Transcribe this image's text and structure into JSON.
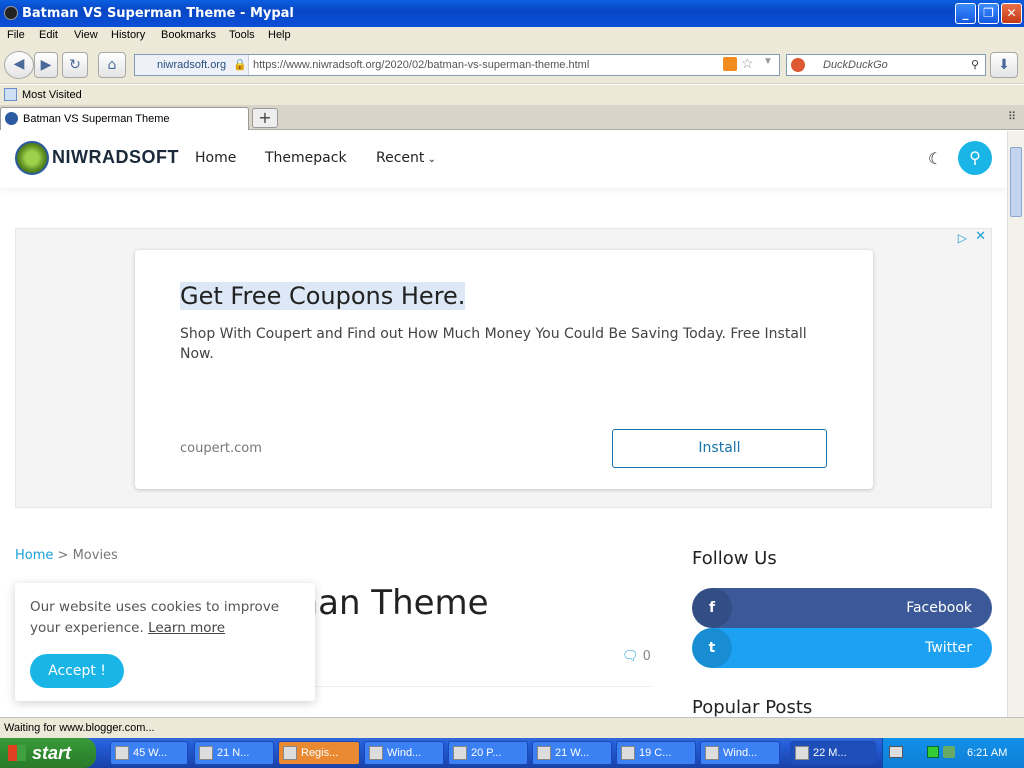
{
  "window": {
    "title": "Batman VS Superman Theme - Mypal"
  },
  "menu": [
    "File",
    "Edit",
    "View",
    "History",
    "Bookmarks",
    "Tools",
    "Help"
  ],
  "navbar": {
    "identity": "niwradsoft.org",
    "url": "https://www.niwradsoft.org/2020/02/batman-vs-superman-theme.html",
    "search_placeholder": "DuckDuckGo"
  },
  "bookmarks": {
    "most_visited": "Most Visited"
  },
  "tabs": [
    {
      "label": "Batman VS Superman Theme"
    }
  ],
  "site": {
    "brand": "NIWRADSOFT",
    "nav": [
      "Home",
      "Themepack",
      "Recent"
    ],
    "ad": {
      "title": "Get Free Coupons Here.",
      "text": "Shop With Coupert and Find out How Much Money You Could Be Saving Today. Free Install Now.",
      "domain": "coupert.com",
      "button": "Install"
    },
    "breadcrumb": {
      "home": "Home",
      "sep": ">",
      "current": "Movies"
    },
    "post_title_visible": "man Theme",
    "comments_count": "0",
    "cookie": {
      "text": "Our website uses cookies to improve your experience.",
      "learn_more": "Learn more",
      "accept": "Accept !"
    },
    "sidebar": {
      "follow_heading": "Follow Us",
      "social": [
        {
          "label": "Facebook",
          "icon": "f",
          "color": "#3b5998"
        },
        {
          "label": "Twitter",
          "icon": "t",
          "color": "#1da1f2"
        }
      ],
      "popular_heading": "Popular Posts"
    }
  },
  "status": {
    "text": "Waiting for www.blogger.com..."
  },
  "taskbar": {
    "start": "start",
    "buttons": [
      "45 W...",
      "21 N...",
      "Regis...",
      "Wind...",
      "20 P...",
      "21 W...",
      "19 C...",
      "Wind...",
      "22 M..."
    ],
    "clock": "6:21 AM"
  },
  "colors": {
    "accent": "#19b5e6",
    "xp_blue": "#245edb"
  }
}
